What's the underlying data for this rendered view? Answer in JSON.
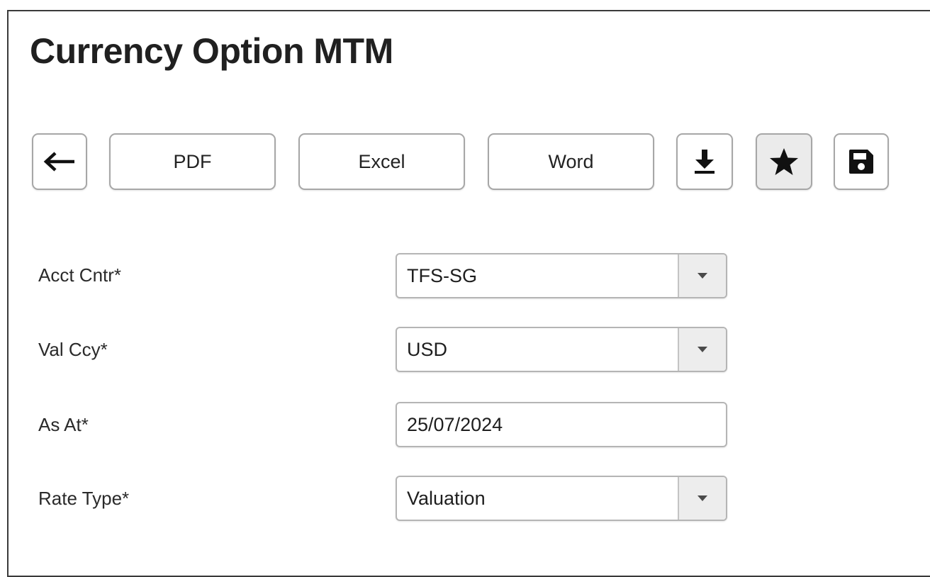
{
  "page": {
    "title": "Currency Option MTM"
  },
  "toolbar": {
    "back_icon": "arrow-left-icon",
    "pdf_label": "PDF",
    "excel_label": "Excel",
    "word_label": "Word",
    "download_icon": "download-icon",
    "favorite_icon": "star-icon",
    "save_icon": "floppy-disk-icon"
  },
  "form": {
    "acct_cntr": {
      "label": "Acct Cntr*",
      "value": "TFS-SG"
    },
    "val_ccy": {
      "label": "Val Ccy*",
      "value": "USD"
    },
    "as_at": {
      "label": "As At*",
      "value": "25/07/2024"
    },
    "rate_type": {
      "label": "Rate Type*",
      "value": "Valuation"
    }
  },
  "colors": {
    "title_text": "#202020",
    "border": "#a7a7a7",
    "dropdown_bg": "#ededed",
    "active_button_bg": "#ebebeb"
  }
}
